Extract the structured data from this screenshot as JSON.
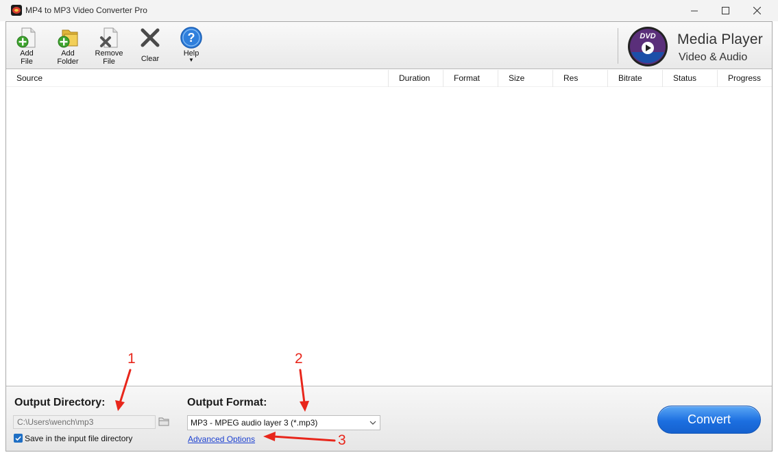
{
  "window": {
    "title": "MP4 to MP3 Video Converter Pro"
  },
  "toolbar": {
    "buttons": [
      {
        "label": "Add\nFile",
        "icon": "add-file-icon"
      },
      {
        "label": "Add\nFolder",
        "icon": "add-folder-icon"
      },
      {
        "label": "Remove\nFile",
        "icon": "remove-file-icon"
      },
      {
        "label": "Clear",
        "icon": "clear-icon"
      },
      {
        "label": "Help",
        "icon": "help-icon"
      }
    ],
    "brand": {
      "title": "Media Player",
      "subtitle": "Video & Audio",
      "logo_text": "DVD"
    }
  },
  "table": {
    "columns": [
      "Source",
      "Duration",
      "Format",
      "Size",
      "Res",
      "Bitrate",
      "Status",
      "Progress"
    ],
    "rows": []
  },
  "output": {
    "directory_label": "Output Directory:",
    "directory_value": "C:\\Users\\wench\\mp3",
    "save_in_input_label": "Save in the input file directory",
    "save_in_input_checked": true,
    "format_label": "Output Format:",
    "format_value": "MP3 - MPEG audio layer 3 (*.mp3)",
    "advanced_options_label": "Advanced Options",
    "convert_label": "Convert"
  },
  "annotations": {
    "numbers": [
      "1",
      "2",
      "3"
    ],
    "color": "#e8261b"
  },
  "colors": {
    "convert_button": "#1c6fe0",
    "link": "#1a3fd0",
    "checkbox": "#1f6fc4"
  }
}
